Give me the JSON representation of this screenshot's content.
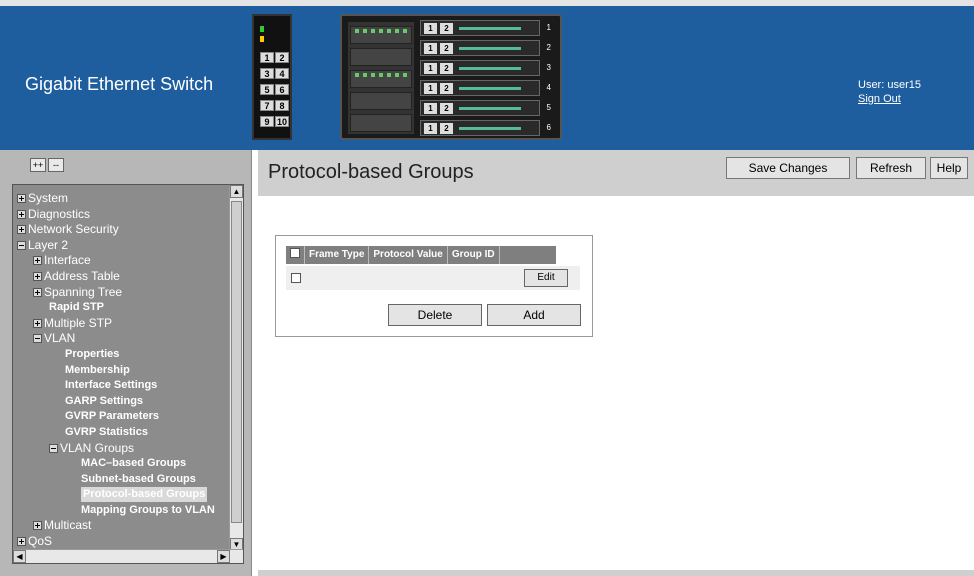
{
  "header": {
    "title": "Gigabit Ethernet Switch",
    "user_label": "User: user15",
    "sign_out": "Sign Out"
  },
  "switch_graphic": {
    "stack_ports": [
      "1",
      "2",
      "3",
      "4",
      "5",
      "6",
      "7",
      "8",
      "9",
      "10"
    ],
    "blade_ports": [
      "1",
      "2"
    ],
    "blade_indices": [
      "1",
      "2",
      "3",
      "4",
      "5",
      "6"
    ]
  },
  "sidebar": {
    "expand_all": "++",
    "collapse_all": "--",
    "items": [
      {
        "label": "System",
        "level": 0,
        "icon": "plus",
        "bold": false
      },
      {
        "label": "Diagnostics",
        "level": 0,
        "icon": "plus",
        "bold": false
      },
      {
        "label": "Network Security",
        "level": 0,
        "icon": "plus",
        "bold": false
      },
      {
        "label": "Layer 2",
        "level": 0,
        "icon": "minus",
        "bold": false
      },
      {
        "label": "Interface",
        "level": 1,
        "icon": "plus",
        "bold": false
      },
      {
        "label": "Address Table",
        "level": 1,
        "icon": "plus",
        "bold": false
      },
      {
        "label": "Spanning Tree",
        "level": 1,
        "icon": "plus",
        "bold": false
      },
      {
        "label": "Rapid STP",
        "level": 2,
        "icon": "",
        "bold": true
      },
      {
        "label": "Multiple STP",
        "level": 1,
        "icon": "plus",
        "bold": false
      },
      {
        "label": "VLAN",
        "level": 1,
        "icon": "minus",
        "bold": false
      },
      {
        "label": "Properties",
        "level": 3,
        "icon": "",
        "bold": true
      },
      {
        "label": "Membership",
        "level": 3,
        "icon": "",
        "bold": true
      },
      {
        "label": "Interface Settings",
        "level": 3,
        "icon": "",
        "bold": true
      },
      {
        "label": "GARP Settings",
        "level": 3,
        "icon": "",
        "bold": true
      },
      {
        "label": "GVRP Parameters",
        "level": 3,
        "icon": "",
        "bold": true
      },
      {
        "label": "GVRP Statistics",
        "level": 3,
        "icon": "",
        "bold": true
      },
      {
        "label": "VLAN Groups",
        "level": 2,
        "icon": "minus",
        "bold": false
      },
      {
        "label": "MAC–based Groups",
        "level": 4,
        "icon": "",
        "bold": true
      },
      {
        "label": "Subnet-based Groups",
        "level": 4,
        "icon": "",
        "bold": true
      },
      {
        "label": "Protocol-based Groups",
        "level": 4,
        "icon": "",
        "bold": true,
        "selected": true
      },
      {
        "label": "Mapping Groups to VLAN",
        "level": 4,
        "icon": "",
        "bold": true
      },
      {
        "label": "Multicast",
        "level": 1,
        "icon": "plus",
        "bold": false
      },
      {
        "label": "QoS",
        "level": 0,
        "icon": "plus",
        "bold": false
      }
    ]
  },
  "toolbar": {
    "save_changes": "Save Changes",
    "refresh": "Refresh",
    "help": "Help"
  },
  "main": {
    "page_title": "Protocol-based Groups",
    "table": {
      "columns": [
        "Frame Type",
        "Protocol Value",
        "Group ID"
      ]
    },
    "edit_label": "Edit",
    "delete_label": "Delete",
    "add_label": "Add"
  }
}
